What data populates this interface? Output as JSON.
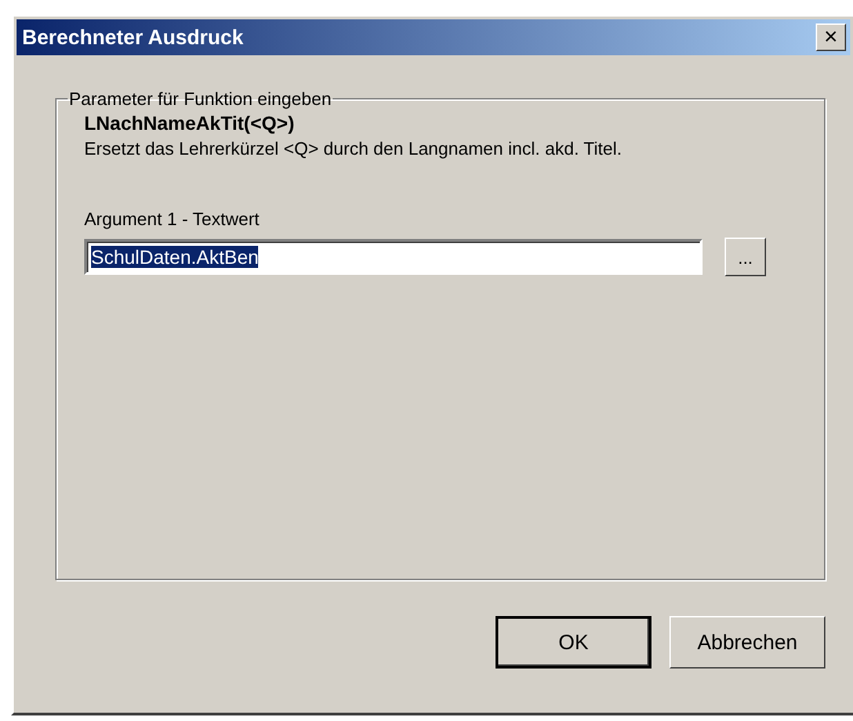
{
  "window": {
    "title": "Berechneter Ausdruck",
    "close_label": "×"
  },
  "group": {
    "caption": "Parameter für Funktion eingeben",
    "function": "LNachNameAkTit(<Q>)",
    "description": "Ersetzt das Lehrerkürzel <Q> durch den Langnamen incl. akd. Titel."
  },
  "argument": {
    "label": "Argument 1 - Textwert",
    "value": "SchulDaten.AktBen",
    "value_selected": true,
    "browse_label": "..."
  },
  "buttons": [
    {
      "label": "OK",
      "default": true
    },
    {
      "label": "Abbrechen",
      "default": false
    }
  ]
}
